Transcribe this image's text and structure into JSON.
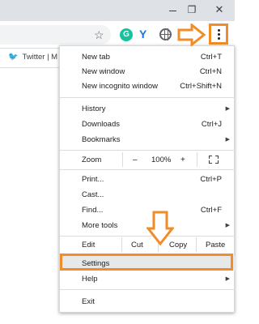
{
  "window": {
    "minimize": "–",
    "maximize": "❐",
    "close": "✕"
  },
  "toolbar": {
    "bookmark_icon": "star-outline-icon",
    "extensions": [
      "grammarly-icon",
      "v-extension-icon",
      "globe-icon"
    ],
    "menu_icon": "three-dots-vertical-icon",
    "grammarly_letter": "G",
    "v_letter": "Y"
  },
  "bookmarks_bar": {
    "items": [
      {
        "icon": "twitter-bird-icon",
        "label": "Twitter | M"
      }
    ]
  },
  "menu": {
    "group1": [
      {
        "label": "New tab",
        "shortcut": "Ctrl+T"
      },
      {
        "label": "New window",
        "shortcut": "Ctrl+N"
      },
      {
        "label": "New incognito window",
        "shortcut": "Ctrl+Shift+N"
      }
    ],
    "group2": [
      {
        "label": "History",
        "submenu": "▶"
      },
      {
        "label": "Downloads",
        "shortcut": "Ctrl+J"
      },
      {
        "label": "Bookmarks",
        "submenu": "▶"
      }
    ],
    "zoom": {
      "label": "Zoom",
      "minus": "–",
      "value": "100%",
      "plus": "+"
    },
    "group3": [
      {
        "label": "Print...",
        "shortcut": "Ctrl+P"
      },
      {
        "label": "Cast..."
      },
      {
        "label": "Find...",
        "shortcut": "Ctrl+F"
      },
      {
        "label": "More tools",
        "submenu": "▶"
      }
    ],
    "edit": {
      "label": "Edit",
      "cut": "Cut",
      "copy": "Copy",
      "paste": "Paste"
    },
    "group4": [
      {
        "label": "Settings"
      },
      {
        "label": "Help",
        "submenu": "▶"
      }
    ],
    "exit": {
      "label": "Exit"
    }
  },
  "annotations": {
    "arrow_color": "#f28c28",
    "highlight_color": "#f28c28"
  }
}
